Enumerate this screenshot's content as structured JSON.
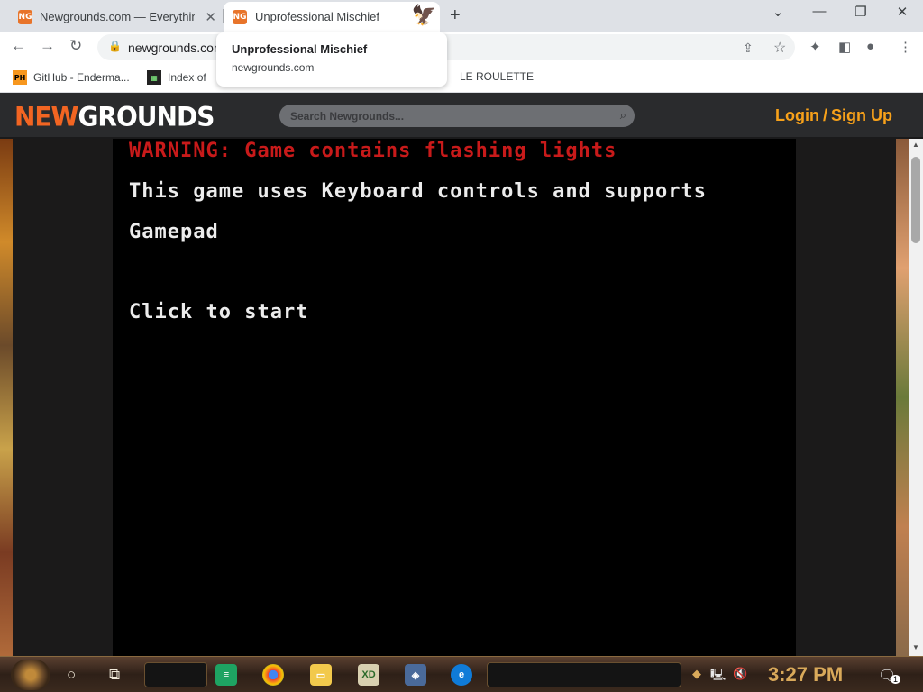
{
  "browser": {
    "tabs": [
      {
        "title": "Newgrounds.com — Everything",
        "favicon": "NG"
      },
      {
        "title": "Unprofessional Mischief",
        "favicon": "NG"
      }
    ],
    "tooltip": {
      "title": "Unprofessional Mischief",
      "domain": "newgrounds.com"
    },
    "url": "newgrounds.com",
    "bookmarks": [
      {
        "label": "GitHub - Enderma...",
        "icon": "PH"
      },
      {
        "label": "Index of",
        "icon": "grid-icon"
      },
      {
        "label": "LE ROULETTE",
        "icon": ""
      }
    ]
  },
  "site": {
    "logo_a": "NEW",
    "logo_b": "GROUNDS",
    "search_placeholder": "Search Newgrounds...",
    "login": "Login",
    "slash": "/",
    "signup": "Sign Up"
  },
  "game": {
    "warning": "WARNING: Game contains flashing lights",
    "controls_line1": "This game uses Keyboard controls and supports",
    "controls_line2": "Gamepad",
    "start": "Click to start"
  },
  "taskbar": {
    "clock": "3:27 PM",
    "notification_count": "1"
  },
  "colors": {
    "ng_orange": "#f26522",
    "ng_gold": "#f7a11a",
    "warning_red": "#c81a1a",
    "clock_gold": "#d9a95a"
  }
}
